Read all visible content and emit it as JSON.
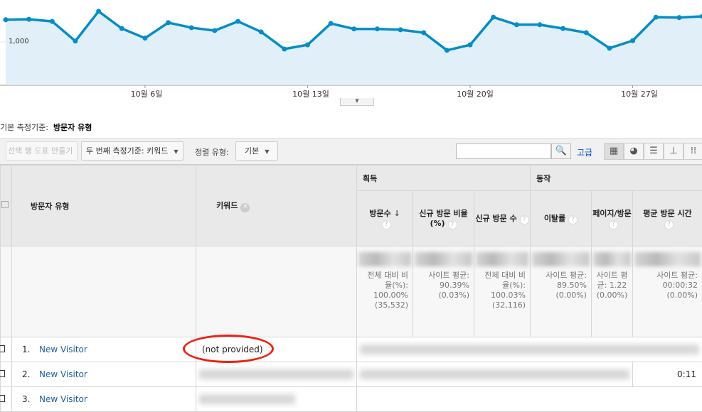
{
  "chart_data": {
    "type": "area",
    "x_tick_labels": [
      "10월 6일",
      "10월 13일",
      "10월 20일",
      "10월 27일"
    ],
    "y_tick_labels": [
      "1,000"
    ],
    "ylim": [
      0,
      2000
    ],
    "values": [
      1530,
      1540,
      1490,
      1020,
      1730,
      1320,
      1090,
      1460,
      1340,
      1270,
      1490,
      1240,
      830,
      930,
      1440,
      1310,
      1310,
      1290,
      1220,
      800,
      930,
      1590,
      1410,
      1410,
      1320,
      1220,
      850,
      1030,
      1590,
      1580,
      1610
    ],
    "line_color": "#058dc7",
    "fill_color": "#e1f0f8",
    "grid": true
  },
  "dimension": {
    "label": "기본 측정기준:",
    "value": "방문자 유형"
  },
  "toolbar": {
    "plot_rows": "선택 행 도표 만들기",
    "secondary": "두 번째 측정기준: 키워드",
    "sort_label": "정렬 유형:",
    "sort_value": "기본",
    "advanced": "고급",
    "search_placeholder": ""
  },
  "views": [
    "table-icon",
    "pie-icon",
    "bar-icon",
    "comparison-icon",
    "pivot-icon"
  ],
  "table": {
    "col_visitor_type": "방문자 유형",
    "col_keyword": "키워드",
    "group_acquisition": "획득",
    "group_behavior": "동작",
    "metrics": [
      "방문수",
      "신규 방문 비율(%)",
      "신규 방문 수",
      "이탈률",
      "페이지/방문",
      "평균 방문 시간"
    ],
    "totals": [
      "전체 대비 비율(%): 100.00% (35,532)",
      "사이트 평균: 90.39% (0.03%)",
      "전체 대비 비율(%): 100.03% (32,116)",
      "사이트 평균: 89.50% (0.00%)",
      "사이트 평균: 1.22 (0.00%)",
      "사이트 평균: 00:00:32 (0.00%)"
    ],
    "rows": [
      {
        "num": "1.",
        "type": "New Visitor",
        "keyword": "(not provided)",
        "last": ""
      },
      {
        "num": "2.",
        "type": "New Visitor",
        "keyword": "",
        "last": "0:11"
      },
      {
        "num": "3.",
        "type": "New Visitor",
        "keyword": "",
        "last": ""
      }
    ]
  }
}
